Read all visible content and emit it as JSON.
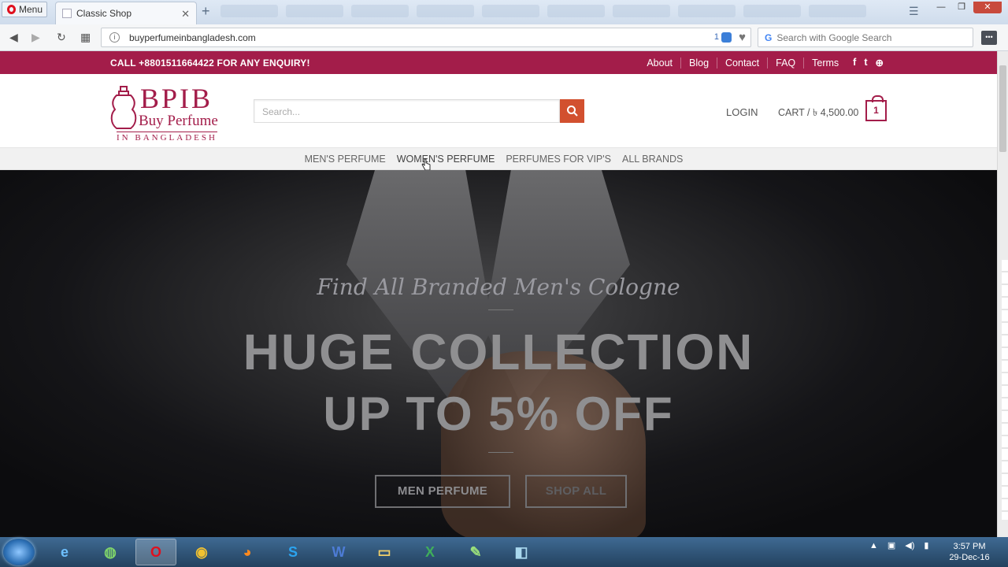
{
  "browser": {
    "menu_label": "Menu",
    "tab_title": "Classic Shop",
    "url": "buyperfumeinbangladesh.com",
    "block_count": "1",
    "search_placeholder": "Search with Google Search"
  },
  "site": {
    "call_text": "CALL +8801511664422 FOR ANY ENQUIRY!",
    "top_links": [
      "About",
      "Blog",
      "Contact",
      "FAQ",
      "Terms"
    ],
    "social": [
      "facebook-icon",
      "twitter-icon",
      "pinterest-icon"
    ],
    "logo": {
      "main": "BPIB",
      "sub": "Buy Perfume",
      "tag": "IN BANGLADESH"
    },
    "search_placeholder": "Search...",
    "login_label": "LOGIN",
    "cart_label": "CART / ৳ 4,500.00",
    "cart_count": "1",
    "nav": [
      "MEN'S PERFUME",
      "WOMEN'S PERFUME",
      "PERFUMES FOR VIP'S",
      "ALL BRANDS"
    ],
    "nav_active": "WOMEN'S PERFUME"
  },
  "hero": {
    "script_line": "Find All Branded Men's Cologne",
    "headline_1": "HUGE COLLECTION",
    "headline_2": "UP TO 5% OFF",
    "button_1": "MEN PERFUME",
    "button_2": "SHOP ALL"
  },
  "taskbar": {
    "apps": [
      "ie-icon",
      "globe-icon",
      "opera-icon",
      "chrome-icon",
      "firefox-icon",
      "skype-icon",
      "word-icon",
      "explorer-icon",
      "excel-icon",
      "chart-app-icon",
      "mail-icon"
    ],
    "active_app": "opera-icon",
    "time": "3:57 PM",
    "date": "29-Dec-16"
  }
}
